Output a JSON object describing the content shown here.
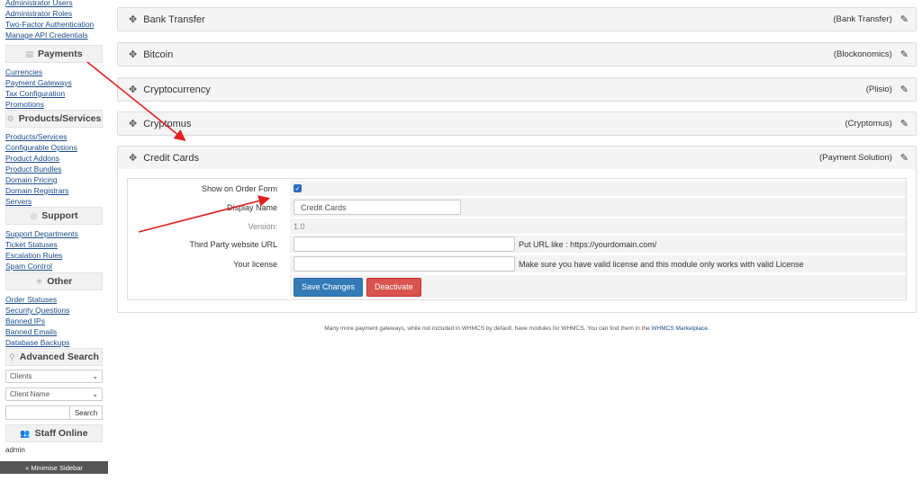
{
  "sidebar": {
    "top_links": [
      "Administrator Users",
      "Administrator Roles",
      "Two-Factor Authentication",
      "Manage API Credentials"
    ],
    "sections": [
      {
        "title": "Payments",
        "icon": "payments-icon",
        "links": [
          "Currencies",
          "Payment Gateways",
          "Tax Configuration",
          "Promotions"
        ]
      },
      {
        "title": "Products/Services",
        "icon": "products-icon",
        "links": [
          "Products/Services",
          "Configurable Options",
          "Product Addons",
          "Product Bundles",
          "Domain Pricing",
          "Domain Registrars",
          "Servers"
        ]
      },
      {
        "title": "Support",
        "icon": "support-icon",
        "links": [
          "Support Departments",
          "Ticket Statuses",
          "Escalation Rules",
          "Spam Control"
        ]
      },
      {
        "title": "Other",
        "icon": "other-icon",
        "links": [
          "Order Statuses",
          "Security Questions",
          "Banned IPs",
          "Banned Emails",
          "Database Backups"
        ]
      }
    ],
    "advanced_search": {
      "title": "Advanced Search",
      "select1": "Clients",
      "select2": "Client Name",
      "search_button": "Search"
    },
    "staff_online": {
      "title": "Staff Online",
      "name": "admin"
    },
    "minimise": "« Minimise Sidebar"
  },
  "gateways": [
    {
      "name": "Bank Transfer",
      "module": "(Bank Transfer)"
    },
    {
      "name": "Bitcoin",
      "module": "(Blockonomics)"
    },
    {
      "name": "Cryptocurrency",
      "module": "(Plisio)"
    },
    {
      "name": "Cryptomus",
      "module": "(Cryptomus)"
    },
    {
      "name": "Credit Cards",
      "module": "(Payment Solution)"
    }
  ],
  "form": {
    "show_on_order_label": "Show on Order Form",
    "show_on_order_checked": true,
    "display_name_label": "Display Name",
    "display_name_value": "Credit Cards",
    "version_label": "Version:",
    "version_value": "1.0",
    "third_party_label": "Third Party website URL",
    "third_party_value": "",
    "third_party_hint": "Put URL like : https://yourdomain.com/",
    "license_label": "Your license",
    "license_value": "",
    "license_hint": "Make sure you have valid license and this module only works with valid License",
    "save_button": "Save Changes",
    "deactivate_button": "Deactivate"
  },
  "footer": {
    "text": "Many more payment gateways, while not included in WHMCS by default, have modules for WHMCS. You can find them in the",
    "link": "WHMCS Marketplace",
    "suffix": "."
  },
  "colors": {
    "link": "#1a4c8c",
    "primary": "#337ab7",
    "danger": "#d9534f",
    "annotation_arrow": "#e02020"
  }
}
